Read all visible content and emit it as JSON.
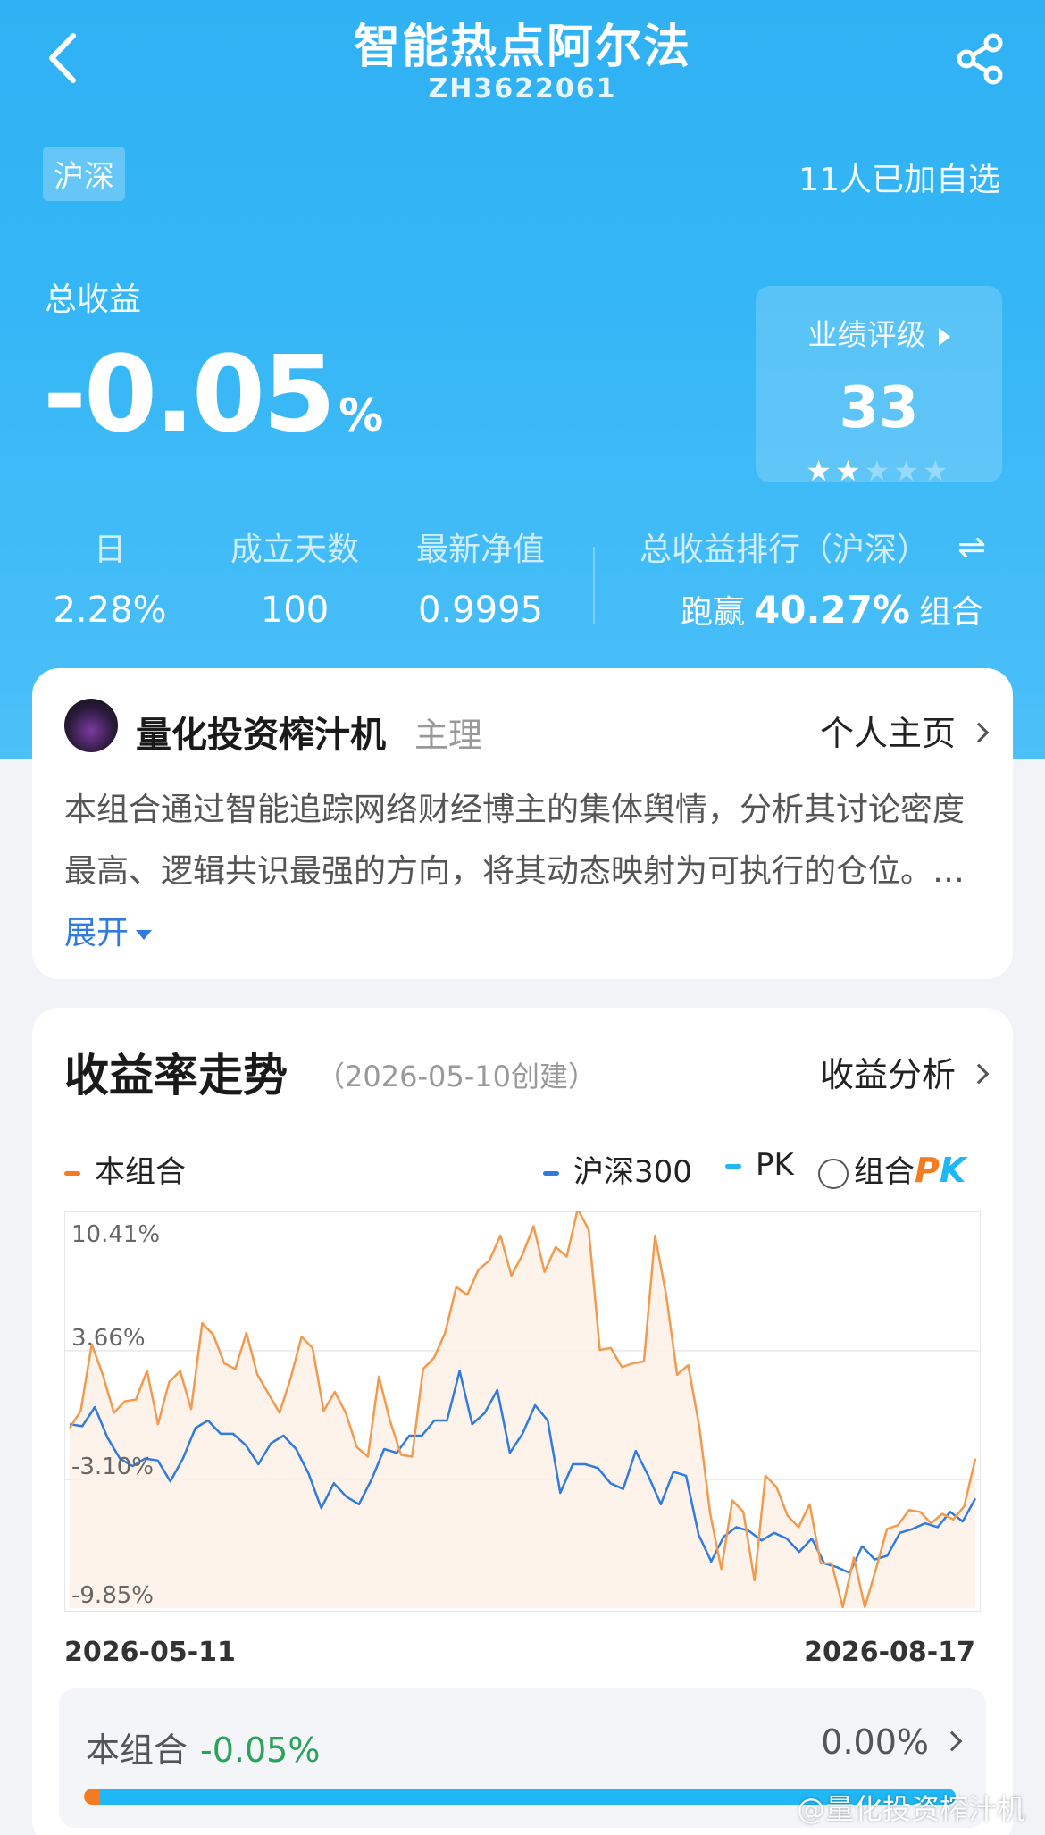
{
  "header": {
    "title": "智能热点阿尔法",
    "code": "ZH3622061",
    "market_tag": "沪深",
    "follow_count": "11人已加自选"
  },
  "summary": {
    "total_label": "总收益",
    "total_value": "-0.05",
    "total_unit": "%",
    "rating_label": "业绩评级",
    "rating_value": "33",
    "rating_stars": 2,
    "rating_stars_max": 5
  },
  "stats": [
    {
      "label": "日",
      "value": "2.28%"
    },
    {
      "label": "成立天数",
      "value": "100"
    },
    {
      "label": "最新净值",
      "value": "0.9995"
    }
  ],
  "rank": {
    "label": "总收益排行（沪深）",
    "prefix": "跑赢",
    "value": "40.27%",
    "suffix": "组合"
  },
  "manager": {
    "name": "量化投资榨汁机",
    "role": "主理",
    "homepage": "个人主页",
    "description": "本组合通过智能追踪网络财经博主的集体舆情，分析其讨论密度最高、逻辑共识最强的方向，将其动态映射为可执行的仓位。…",
    "expand": "展开"
  },
  "trend": {
    "title": "收益率走势",
    "created": "（2026-05-10创建）",
    "analysis": "收益分析",
    "pk_text": "组合",
    "pk_badge": "PK"
  },
  "chart_data": {
    "type": "area",
    "series": [
      {
        "name": "本组合",
        "color": "#f29a4f",
        "values": [
          -0.4,
          0.5,
          4.0,
          2.4,
          0.4,
          1.0,
          1.1,
          2.6,
          -0.2,
          2.0,
          2.6,
          0.6,
          5.1,
          4.5,
          3.0,
          2.7,
          4.6,
          2.4,
          1.4,
          0.4,
          2.2,
          4.4,
          3.8,
          0.5,
          1.5,
          0.4,
          -1.4,
          -1.9,
          2.3,
          0.0,
          -1.8,
          -1.9,
          2.7,
          3.3,
          4.6,
          7.0,
          6.6,
          7.9,
          8.4,
          9.7,
          7.6,
          8.7,
          10.2,
          7.8,
          9.1,
          8.6,
          11.1,
          10.0,
          3.7,
          3.8,
          2.8,
          3.0,
          3.1,
          9.7,
          6.6,
          2.4,
          2.9,
          -0.3,
          -4.9,
          -7.8,
          -4.2,
          -4.8,
          -8.4,
          -2.9,
          -3.5,
          -5.0,
          -5.6,
          -4.4,
          -7.5,
          -7.5,
          -9.8,
          -7.2,
          -9.8,
          -7.8,
          -5.7,
          -5.5,
          -4.7,
          -4.8,
          -5.4,
          -4.9,
          -5.2,
          -4.5,
          -2.0
        ]
      },
      {
        "name": "沪深300",
        "color": "#2f7be0",
        "values": [
          -0.2,
          -0.3,
          0.7,
          -0.9,
          -2.0,
          -2.4,
          -2.0,
          -2.1,
          -3.2,
          -2.0,
          -0.4,
          0.0,
          -0.7,
          -0.7,
          -1.3,
          -2.3,
          -1.2,
          -0.8,
          -1.5,
          -2.8,
          -4.6,
          -3.3,
          -4.0,
          -4.4,
          -3.1,
          -1.5,
          -1.7,
          -0.8,
          -0.8,
          0.0,
          0.0,
          2.6,
          -0.2,
          0.4,
          1.6,
          -1.7,
          -0.7,
          0.8,
          0.0,
          -3.8,
          -2.3,
          -2.3,
          -2.5,
          -3.3,
          -3.6,
          -1.6,
          -2.9,
          -4.4,
          -2.7,
          -2.9,
          -6.0,
          -7.4,
          -6.1,
          -5.6,
          -5.8,
          -6.3,
          -5.9,
          -6.2,
          -6.9,
          -6.2,
          -7.5,
          -7.7,
          -8.0,
          -6.6,
          -7.3,
          -7.1,
          -5.9,
          -5.7,
          -5.4,
          -5.6,
          -4.8,
          -5.3,
          -4.1
        ]
      }
    ],
    "x_start": "2026-05-11",
    "x_end": "2026-08-17",
    "y_ticks": [
      "10.41%",
      "3.66%",
      "-3.10%",
      "-9.85%"
    ],
    "ylim": [
      -9.85,
      10.41
    ],
    "grid": true,
    "legend": [
      {
        "name": "本组合",
        "color": "#f47b20"
      },
      {
        "name": "沪深300",
        "color": "#2f7be0"
      },
      {
        "name": "PK",
        "color": "#1fb7f6"
      }
    ]
  },
  "compare": {
    "own_label": "本组合",
    "own_value": "-0.05%",
    "other_value": "0.00%"
  },
  "watermark": "@量化投资榨汁机"
}
